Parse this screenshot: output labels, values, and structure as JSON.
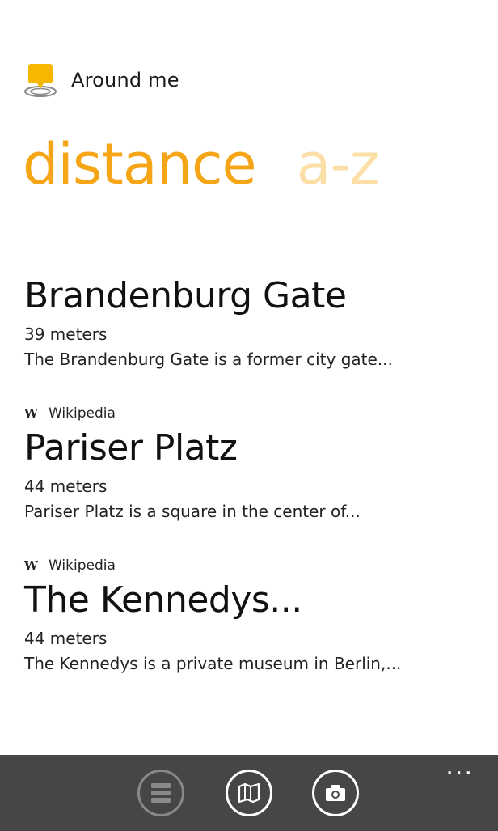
{
  "app": {
    "title": "Around me",
    "logo_icon": "location-pin-icon",
    "accent_color": "#f5a515",
    "inactive_pivot_color": "#fbdfa7"
  },
  "pivot": {
    "tabs": [
      {
        "label": "distance",
        "active": true
      },
      {
        "label": "a-z",
        "active": false
      }
    ]
  },
  "items": [
    {
      "title": "Brandenburg Gate",
      "distance": "39 meters",
      "description": "The Brandenburg Gate is a former city gate...",
      "source": null
    },
    {
      "title": "Pariser Platz",
      "distance": "44 meters",
      "description": "Pariser Platz is a square in the center of...",
      "source": {
        "icon": "W",
        "label": "Wikipedia"
      }
    },
    {
      "title": "The Kennedys...",
      "distance": "44 meters",
      "description": "The Kennedys is a private museum in Berlin,...",
      "source": {
        "icon": "W",
        "label": "Wikipedia"
      }
    }
  ],
  "appbar": {
    "background": "#464646",
    "buttons": [
      {
        "icon": "list-icon",
        "state": "disabled"
      },
      {
        "icon": "map-icon",
        "state": "enabled"
      },
      {
        "icon": "camera-icon",
        "state": "enabled"
      }
    ],
    "more_label": "..."
  }
}
